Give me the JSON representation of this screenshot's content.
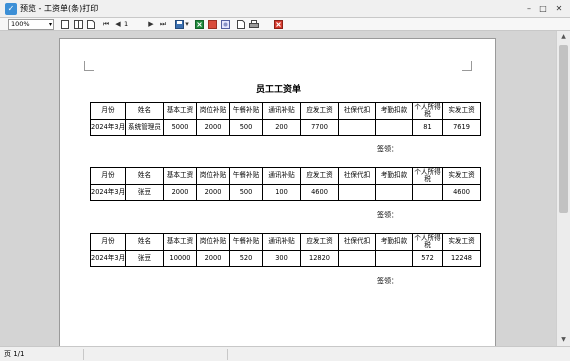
{
  "window": {
    "title": "预览 - 工资单(条)打印",
    "minimize": "–",
    "maximize": "□",
    "close": "✕"
  },
  "toolbar": {
    "zoom": "100%",
    "page_input": "1"
  },
  "document": {
    "title": "员工工资单",
    "headers": [
      "月份",
      "姓名",
      "基本工资",
      "岗位补贴",
      "午餐补贴",
      "通讯补贴",
      "应发工资",
      "社保代扣",
      "考勤扣款",
      "个人所得税",
      "实发工资"
    ],
    "records": [
      {
        "cells": [
          "2024年3月",
          "系统管理员",
          "5000",
          "2000",
          "500",
          "200",
          "7700",
          "",
          "",
          "81",
          "7619"
        ]
      },
      {
        "cells": [
          "2024年3月",
          "张豆",
          "2000",
          "2000",
          "500",
          "100",
          "4600",
          "",
          "",
          "",
          "4600"
        ]
      },
      {
        "cells": [
          "2024年3月",
          "张豆",
          "10000",
          "2000",
          "520",
          "300",
          "12820",
          "",
          "",
          "572",
          "12248"
        ]
      }
    ],
    "sign_label": "签领："
  },
  "status": {
    "page": "页 1/1"
  }
}
